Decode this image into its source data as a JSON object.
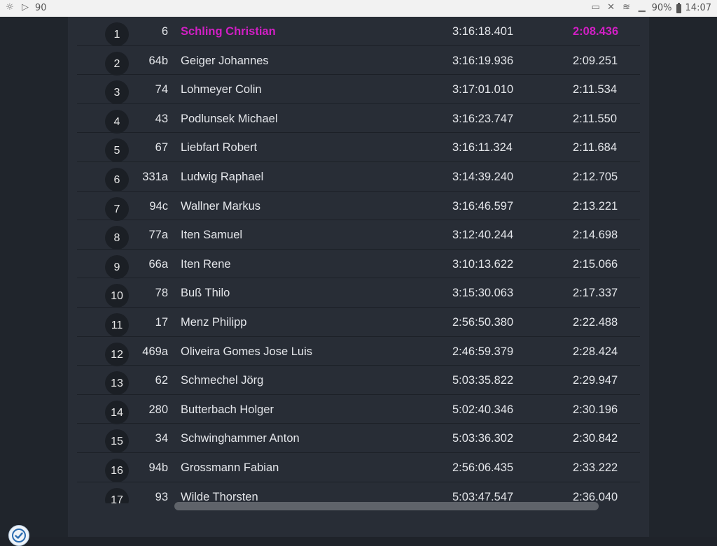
{
  "status_bar": {
    "notification_count": "90",
    "battery": "90%",
    "time": "14:07"
  },
  "results": [
    {
      "pos": "1",
      "num": "6",
      "name": "Schling Christian",
      "total": "3:16:18.401",
      "best": "2:08.436",
      "highlight": true
    },
    {
      "pos": "2",
      "num": "64b",
      "name": "Geiger Johannes",
      "total": "3:16:19.936",
      "best": "2:09.251"
    },
    {
      "pos": "3",
      "num": "74",
      "name": "Lohmeyer Colin",
      "total": "3:17:01.010",
      "best": "2:11.534"
    },
    {
      "pos": "4",
      "num": "43",
      "name": "Podlunsek Michael",
      "total": "3:16:23.747",
      "best": "2:11.550"
    },
    {
      "pos": "5",
      "num": "67",
      "name": "Liebfart Robert",
      "total": "3:16:11.324",
      "best": "2:11.684"
    },
    {
      "pos": "6",
      "num": "331a",
      "name": "Ludwig Raphael",
      "total": "3:14:39.240",
      "best": "2:12.705"
    },
    {
      "pos": "7",
      "num": "94c",
      "name": "Wallner Markus",
      "total": "3:16:46.597",
      "best": "2:13.221"
    },
    {
      "pos": "8",
      "num": "77a",
      "name": "Iten Samuel",
      "total": "3:12:40.244",
      "best": "2:14.698"
    },
    {
      "pos": "9",
      "num": "66a",
      "name": "Iten Rene",
      "total": "3:10:13.622",
      "best": "2:15.066"
    },
    {
      "pos": "10",
      "num": "78",
      "name": "Buß Thilo",
      "total": "3:15:30.063",
      "best": "2:17.337"
    },
    {
      "pos": "11",
      "num": "17",
      "name": "Menz Philipp",
      "total": "2:56:50.380",
      "best": "2:22.488"
    },
    {
      "pos": "12",
      "num": "469a",
      "name": "Oliveira Gomes Jose Luis",
      "total": "2:46:59.379",
      "best": "2:28.424"
    },
    {
      "pos": "13",
      "num": "62",
      "name": "Schmechel Jörg",
      "total": "5:03:35.822",
      "best": "2:29.947"
    },
    {
      "pos": "14",
      "num": "280",
      "name": "Butterbach Holger",
      "total": "5:02:40.346",
      "best": "2:30.196"
    },
    {
      "pos": "15",
      "num": "34",
      "name": "Schwinghammer Anton",
      "total": "5:03:36.302",
      "best": "2:30.842"
    },
    {
      "pos": "16",
      "num": "94b",
      "name": "Grossmann Fabian",
      "total": "2:56:06.435",
      "best": "2:33.222"
    },
    {
      "pos": "17",
      "num": "93",
      "name": "Wilde Thorsten",
      "total": "5:03:47.547",
      "best": "2:36.040"
    }
  ],
  "colors": {
    "highlight": "#d11fc4",
    "panel_bg": "#282d36",
    "page_bg": "#20252c"
  }
}
